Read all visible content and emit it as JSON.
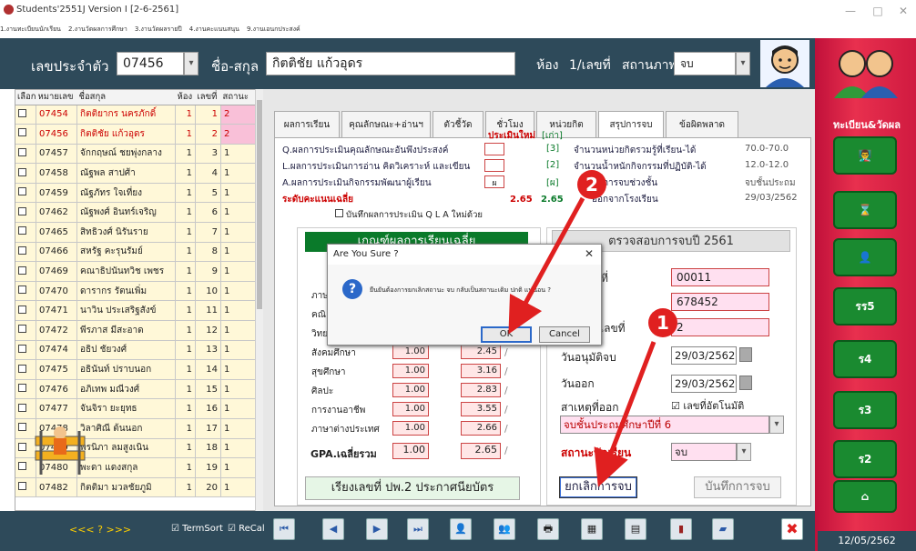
{
  "window": {
    "title": "Students'2551J Version I [2-6-2561]"
  },
  "menu": [
    "1.งานทะเบียนนักเรียน",
    "2.งานวัดผลการศึกษา",
    "3.งานวัดผลรายปี",
    "4.งานคะแนนสนุน",
    "9.งานเอนกประสงค์"
  ],
  "top": {
    "id_label": "เลขประจำตัว",
    "id_value": "07456",
    "name_label": "ชื่อ-สกุล",
    "name_value": "กิตติชัย แก้วอุดร",
    "room_label": "ห้อง",
    "room_value": "1/เลขที่",
    "status_label": "สถานภาพ",
    "status_value": "จบ"
  },
  "list": {
    "headers": [
      "เลือก",
      "หมายเลข",
      "ชื่อสกุล",
      "ห้อง",
      "เลขที่",
      "สถานะ"
    ],
    "rows": [
      {
        "id": "07454",
        "name": "กิตติยากร นครภักดิ์",
        "room": "1",
        "no": "1",
        "st": "2"
      },
      {
        "id": "07456",
        "name": "กิตติชัย แก้วอุดร",
        "room": "1",
        "no": "2",
        "st": "2"
      },
      {
        "id": "07457",
        "name": "จักกฤษณ์ ชยพุ่งกลาง",
        "room": "1",
        "no": "3",
        "st": "1"
      },
      {
        "id": "07458",
        "name": "ณัฐพล สาปศ้า",
        "room": "1",
        "no": "4",
        "st": "1"
      },
      {
        "id": "07459",
        "name": "ณัฐภัทร ใจเที่ยง",
        "room": "1",
        "no": "5",
        "st": "1"
      },
      {
        "id": "07462",
        "name": "ณัฐพงศ์ อินทร์เจริญ",
        "room": "1",
        "no": "6",
        "st": "1"
      },
      {
        "id": "07465",
        "name": "สิทธิวงศ์ นิรันราย",
        "room": "1",
        "no": "7",
        "st": "1"
      },
      {
        "id": "07466",
        "name": "สหรัฐ คะรุนรัมย์",
        "room": "1",
        "no": "8",
        "st": "1"
      },
      {
        "id": "07469",
        "name": "คณาธิปนันทวิช เพชร",
        "room": "1",
        "no": "9",
        "st": "1"
      },
      {
        "id": "07470",
        "name": "ดารากร รัตนเพิ่ม",
        "room": "1",
        "no": "10",
        "st": "1"
      },
      {
        "id": "07471",
        "name": "นาวิน ประเสริฐสังข์",
        "room": "1",
        "no": "11",
        "st": "1"
      },
      {
        "id": "07472",
        "name": "พีรภาส มีสะอาด",
        "room": "1",
        "no": "12",
        "st": "1"
      },
      {
        "id": "07474",
        "name": "อธิป ชัยวงศ์",
        "room": "1",
        "no": "13",
        "st": "1"
      },
      {
        "id": "07475",
        "name": "อธินันท์ ปราบนอก",
        "room": "1",
        "no": "14",
        "st": "1"
      },
      {
        "id": "07476",
        "name": "อภิเทพ มณีวงศ์",
        "room": "1",
        "no": "15",
        "st": "1"
      },
      {
        "id": "07477",
        "name": "จันจิรา ยะยุทธ",
        "room": "1",
        "no": "16",
        "st": "1"
      },
      {
        "id": "07478",
        "name": "วิลาศิณี ต้นนอก",
        "room": "1",
        "no": "17",
        "st": "1"
      },
      {
        "id": "07479",
        "name": "พรนิภา ลมสูงเนิน",
        "room": "1",
        "no": "18",
        "st": "1"
      },
      {
        "id": "07480",
        "name": "พะดา แดงสกุล",
        "room": "1",
        "no": "19",
        "st": "1"
      },
      {
        "id": "07482",
        "name": "กิตติมา มวลชัยภูมิ",
        "room": "1",
        "no": "20",
        "st": "1"
      }
    ]
  },
  "tabs": [
    "ผลการเรียน",
    "คุณลักษณะ+อ่านฯ",
    "ตัวชี้วัด",
    "ชั่วโมง",
    "หน่วยกิต",
    "สรุปการจบ",
    "ข้อผิดพลาด"
  ],
  "summary": {
    "col_new": "ประเมินใหม่",
    "col_old": "[เก่า]",
    "q_label": "Q.ผลการประเมินคุณลักษณะอันพึงประสงค์",
    "q_old": "[3]",
    "l_label": "L.ผลการประเมินการอ่าน คิดวิเคราะห์ และเขียน",
    "l_old": "[2]",
    "a_label": "A.ผลการประเมินกิจกรรมพัฒนาผู้เรียน",
    "a_new": "ผ",
    "a_old": "[ผ]",
    "avg_label": "ระดับคะแนนเฉลี่ย",
    "avg_new": "2.65",
    "avg_old": "2.65",
    "save_qla": "บันทึกผลการประเมิน Q L A ใหม่ด้วย",
    "credit_label": "จำนวนหน่วยกิตรวมรู้ที่เรียน-ได้",
    "credit_val": "70.0-70.0",
    "weight_label": "จำนวนน้ำหนักกิจกรรมที่ปฏิบัติ-ได้",
    "weight_val": "12.0-12.0",
    "end_label": "ผลการจบช่วงชั้น",
    "end_val": "จบชั้นประถม",
    "leave_label": "ออกจากโรงเรียน",
    "leave_val": "29/03/2562"
  },
  "grades": {
    "title": "เกณฑ์ผลการเรียนเฉลี่ย",
    "subjects": [
      {
        "name": "ภาษ",
        "a": "",
        "b": ""
      },
      {
        "name": "คณิ",
        "a": "",
        "b": ""
      },
      {
        "name": "วิทย",
        "a": "",
        "b": ""
      },
      {
        "name": "สังคมศึกษา",
        "a": "1.00",
        "b": "2.45"
      },
      {
        "name": "สุขศึกษา",
        "a": "1.00",
        "b": "3.16"
      },
      {
        "name": "ศิลปะ",
        "a": "1.00",
        "b": "2.83"
      },
      {
        "name": "การงานอาชีพ",
        "a": "1.00",
        "b": "3.55"
      },
      {
        "name": "ภาษาต่างประเทศ",
        "a": "1.00",
        "b": "2.66"
      }
    ],
    "gpa_label": "GPA.เฉลี่ยรวม",
    "gpa_a": "1.00",
    "gpa_b": "2.65",
    "sort_btn": "เรียงเลขที่ ปพ.2 ประกาศนียบัตร"
  },
  "check": {
    "title": "ตรวจสอบการจบปี 2561",
    "f1_label": "ที่",
    "f1": "00011",
    "f2": "678452",
    "f3_label": "เลขที่",
    "f3": "2",
    "approve_label": "วันอนุมัติจบ",
    "approve": "29/03/2562",
    "out_label": "วันออก",
    "out": "29/03/2562",
    "auto_label": "เลขที่อัตโนมัติ",
    "reason_label": "สาเหตุที่ออก",
    "reason": "จบชั้นประถมศึกษาปีที่ 6",
    "status_label": "สถานะนักเรียน",
    "status": "จบ",
    "cancel_btn": "ยกเลิกการจบ",
    "save_btn": "บันทึกการจบ"
  },
  "dialog": {
    "title": "Are You Sure ?",
    "message": "ยืนยันต้องการยกเลิกสถานะ จบ กลับเป็นสถานะเดิม ปกติ แน่นอน ?",
    "ok": "OK",
    "cancel": "Cancel"
  },
  "callouts": [
    "1",
    "2"
  ],
  "footer": {
    "nav": "<<< ? >>>",
    "termsort": "TermSort",
    "recal": "ReCal"
  },
  "right": {
    "title": "ทะเบียน&วัดผล",
    "b1": "รร5",
    "b2": "ร4",
    "b3": "ร3",
    "b4": "ร2",
    "date": "12/05/2562"
  }
}
